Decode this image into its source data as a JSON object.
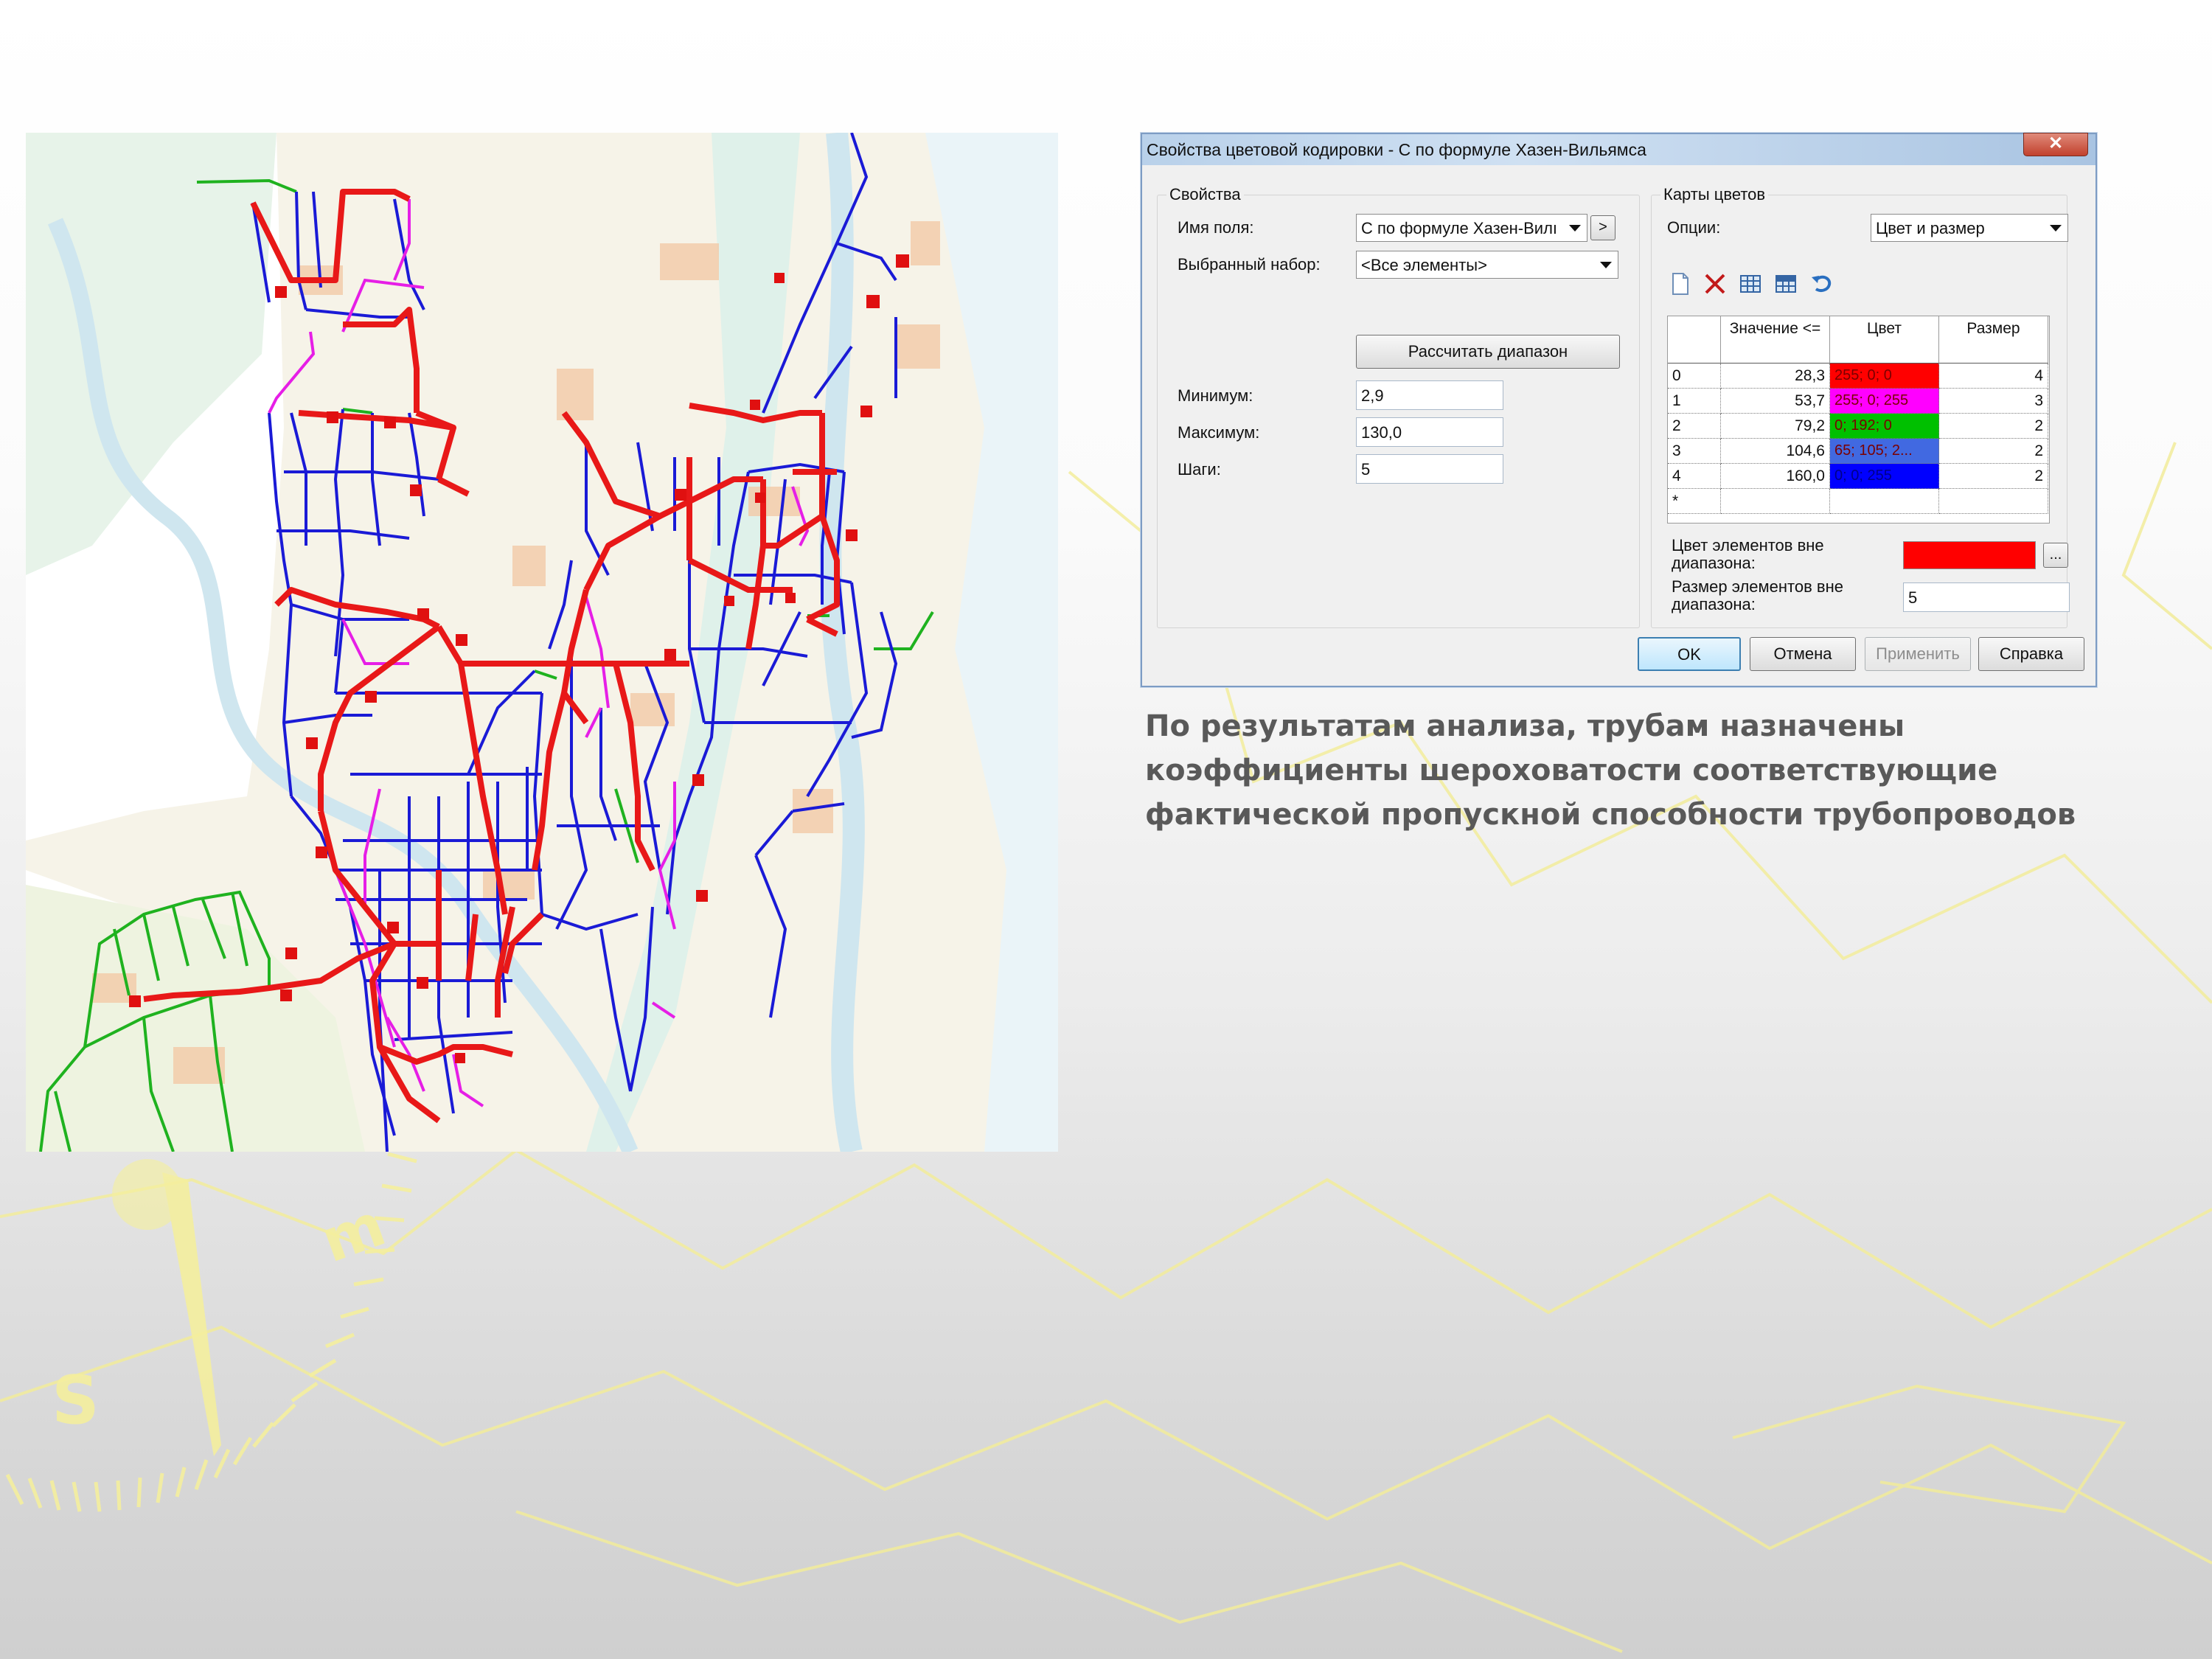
{
  "dialog": {
    "title": "Свойства цветовой кодировки - С по формуле Хазен-Вильямса",
    "close_label": "✕",
    "properties": {
      "legend": "Свойства",
      "field_name_label": "Имя поля:",
      "field_name_value": "С по формуле Хазен-Вилı",
      "more_label": ">",
      "selection_label": "Выбранный набор:",
      "selection_value": "<Все элементы>",
      "calc_range_label": "Рассчитать диапазон",
      "min_label": "Минимум:",
      "min_value": "2,9",
      "max_label": "Максимум:",
      "max_value": "130,0",
      "steps_label": "Шаги:",
      "steps_value": "5"
    },
    "color_maps": {
      "legend": "Карты цветов",
      "options_label": "Опции:",
      "options_value": "Цвет и размер",
      "toolbar_icons": [
        "new-icon",
        "delete-icon",
        "grid-icon",
        "grid-edit-icon",
        "undo-icon"
      ],
      "columns": [
        "",
        "Значение <=",
        "Цвет",
        "Размер"
      ],
      "rows": [
        {
          "index": "0",
          "value": "28,3",
          "color_text": "255; 0; 0",
          "color": "#ff0000",
          "size": "4"
        },
        {
          "index": "1",
          "value": "53,7",
          "color_text": "255; 0; 255",
          "color": "#ff00ff",
          "size": "3"
        },
        {
          "index": "2",
          "value": "79,2",
          "color_text": "0; 192; 0",
          "color": "#00c000",
          "size": "2"
        },
        {
          "index": "3",
          "value": "104,6",
          "color_text": "65; 105; 2...",
          "color": "#4169e1",
          "size": "2"
        },
        {
          "index": "4",
          "value": "160,0",
          "color_text": "0; 0; 255",
          "color": "#0000ff",
          "size": "2"
        }
      ],
      "new_row_marker": "*",
      "out_color_label": "Цвет элементов вне диапазона:",
      "out_color_value": "#ff0000",
      "out_color_button": "...",
      "out_size_label": "Размер элементов вне диапазона:",
      "out_size_value": "5"
    },
    "buttons": {
      "ok": "OK",
      "cancel": "Отмена",
      "apply": "Применить",
      "help": "Справка"
    }
  },
  "caption": "По результатам анализа, трубам назначены коэффициенты шероховатости соответствующие фактической пропускной способности трубопроводов",
  "map": {
    "pipe_colors": {
      "high_loss": "#ff0000",
      "mid_low": "#ff00ff",
      "mid": "#00c000",
      "good": "#0000ff"
    }
  }
}
